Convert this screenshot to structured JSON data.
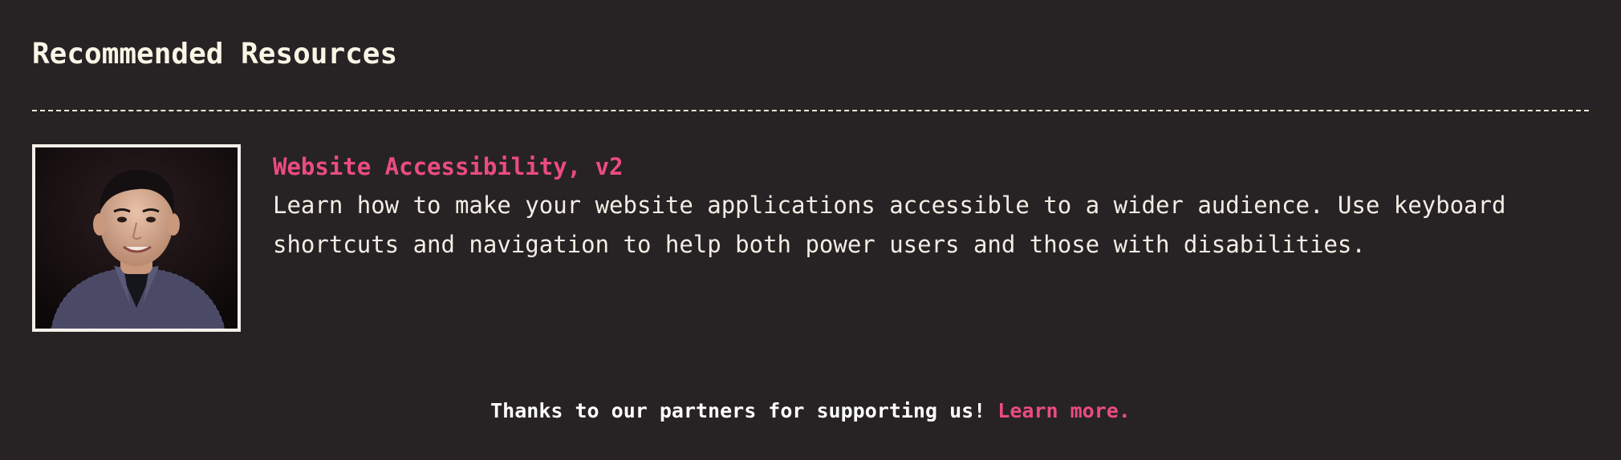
{
  "section": {
    "heading": "Recommended Resources"
  },
  "resource": {
    "title": "Website Accessibility, v2",
    "description": "Learn how to make your website applications accessible to a wider audience. Use keyboard shortcuts and navigation to help both power users and those with disabilities.",
    "image_icon": "instructor-photo"
  },
  "footer": {
    "text": "Thanks to our partners for supporting us!",
    "link_label": "Learn more."
  },
  "colors": {
    "background": "#272325",
    "accent": "#ec4b82",
    "text": "#f3eee4"
  }
}
